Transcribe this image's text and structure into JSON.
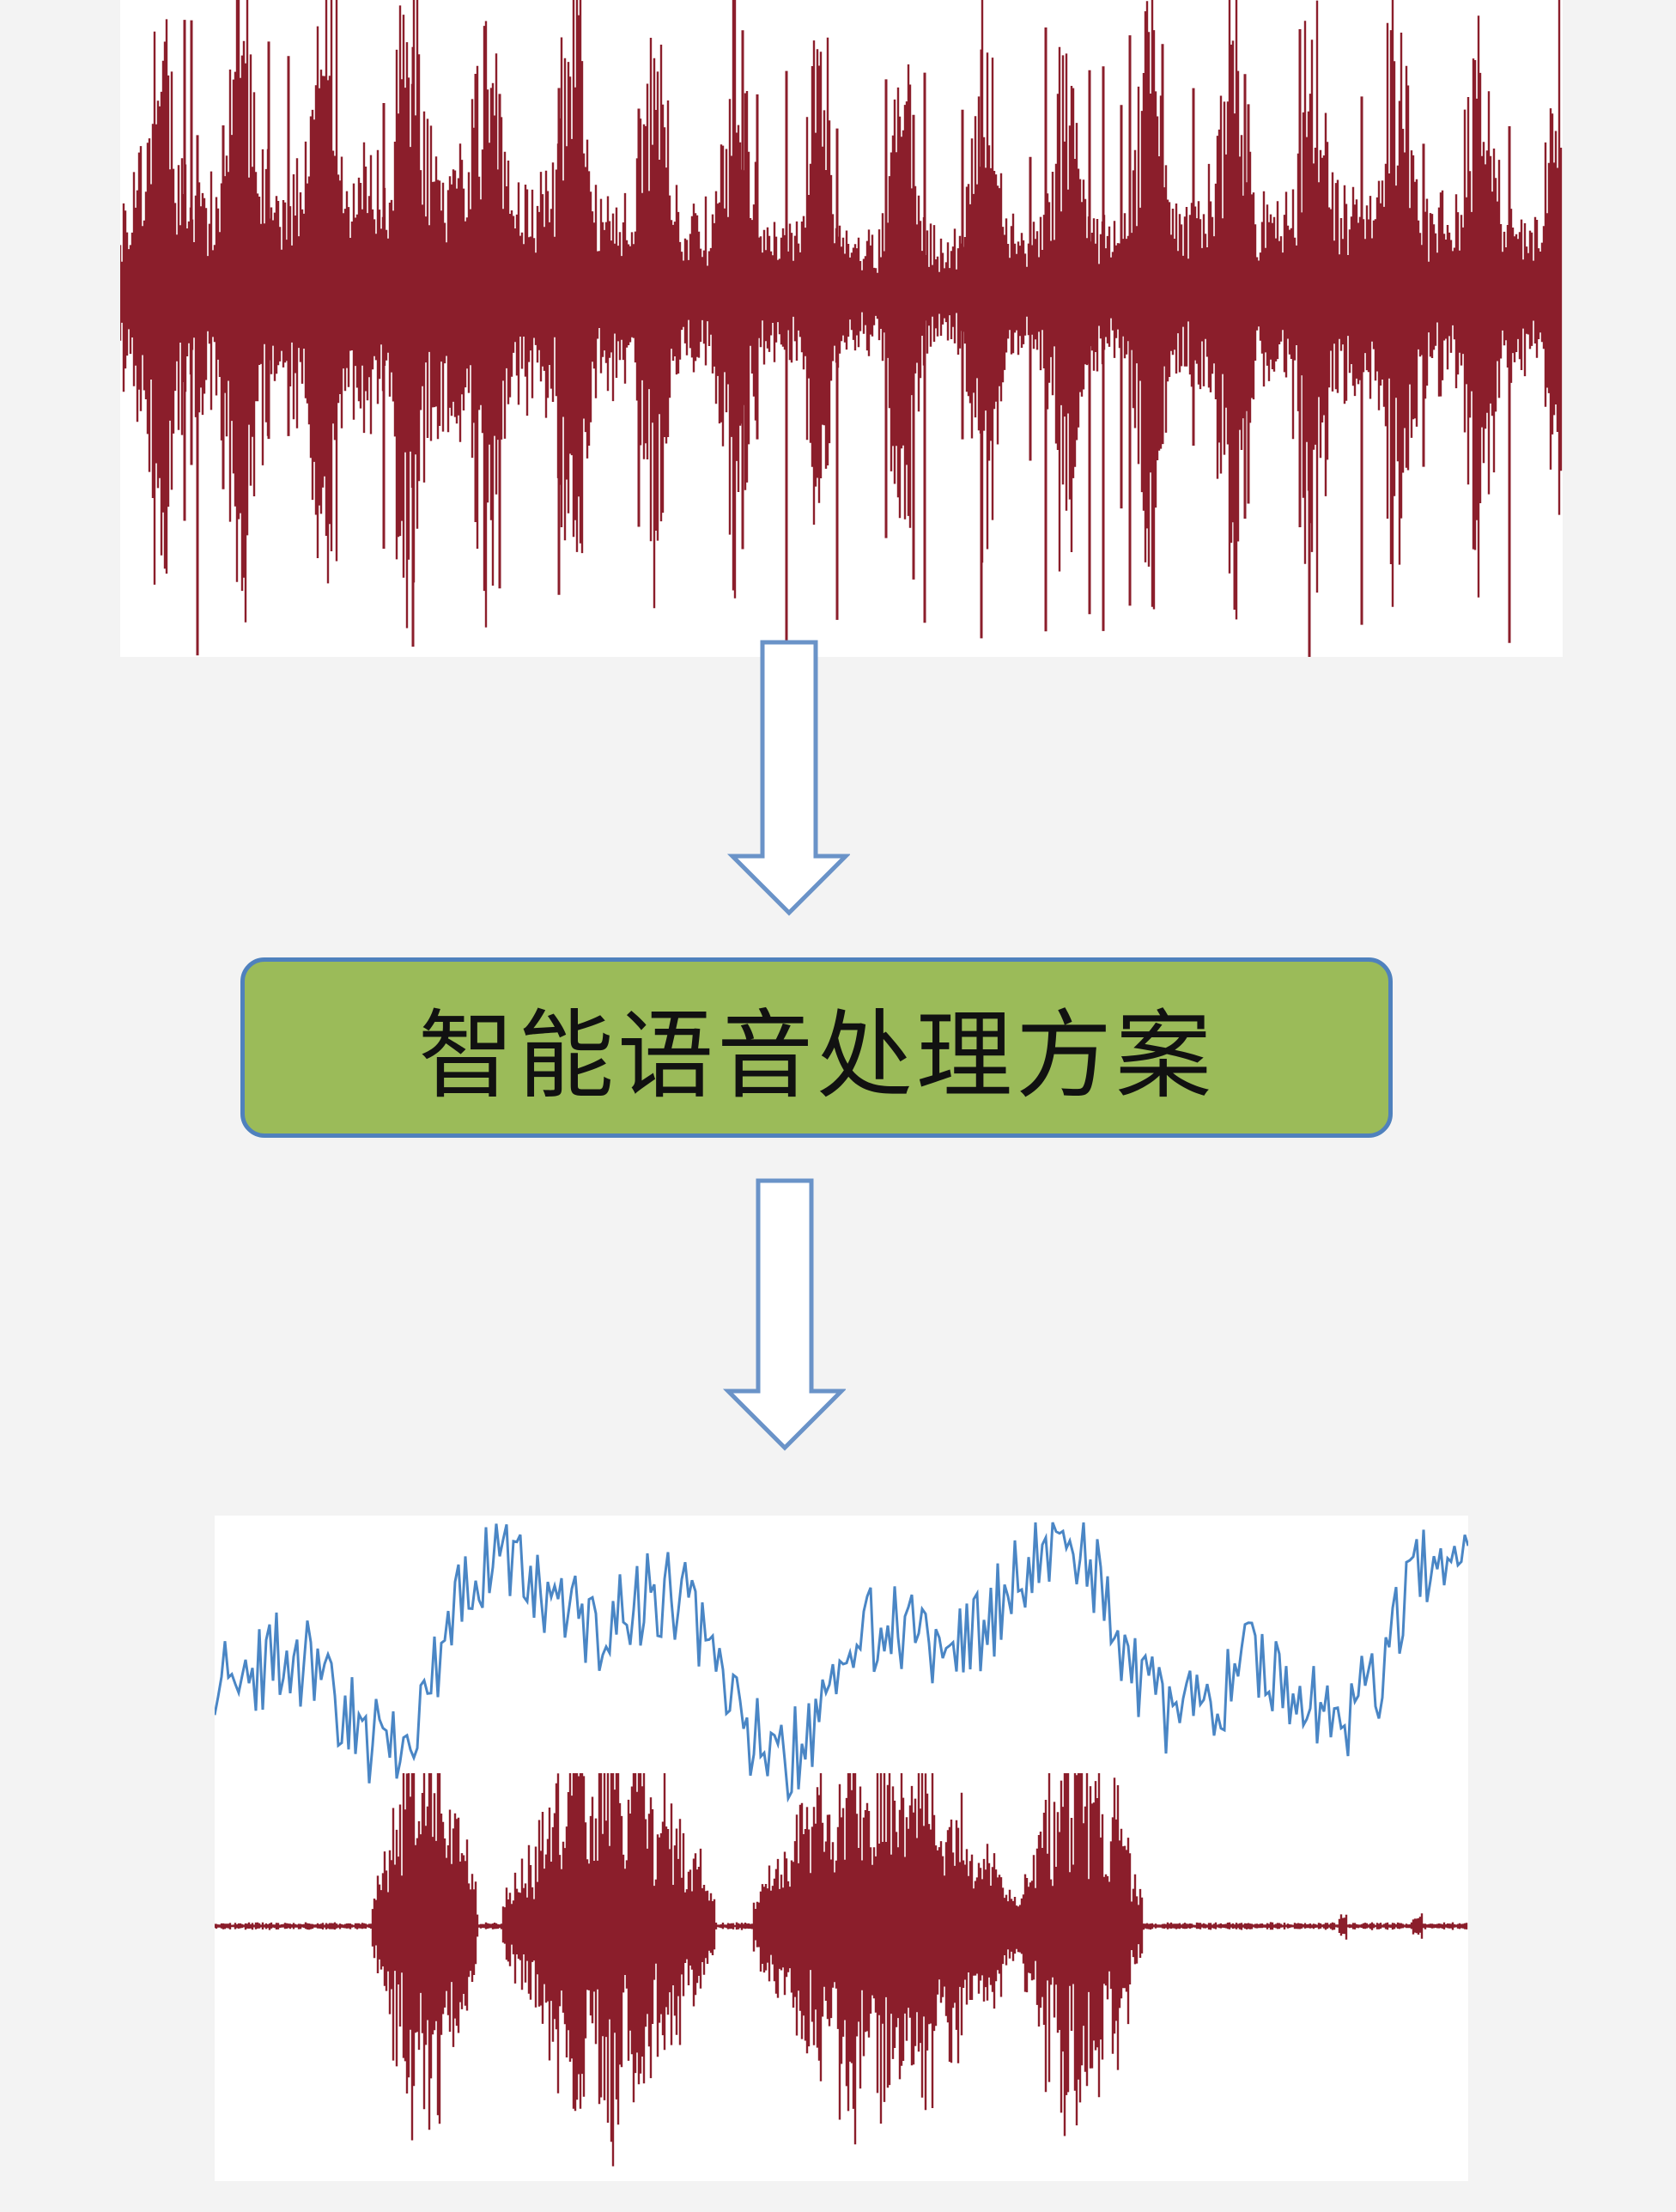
{
  "process": {
    "label": "智能语音处理方案"
  },
  "colors": {
    "background": "#f3f3f3",
    "panel": "#ffffff",
    "waveform": "#8b1e2b",
    "envelope_line": "#4a86c5",
    "box_fill": "#9bbb59",
    "box_border": "#4f81bd",
    "arrow_stroke": "#6a93c8"
  },
  "icons": {
    "arrow_1": "down-arrow-outline-icon",
    "arrow_2": "down-arrow-outline-icon"
  },
  "chart_data": [
    {
      "type": "line",
      "series": [
        {
          "values": []
        }
      ]
    },
    {
      "type": "line",
      "series": [
        {
          "values": []
        }
      ]
    }
  ]
}
